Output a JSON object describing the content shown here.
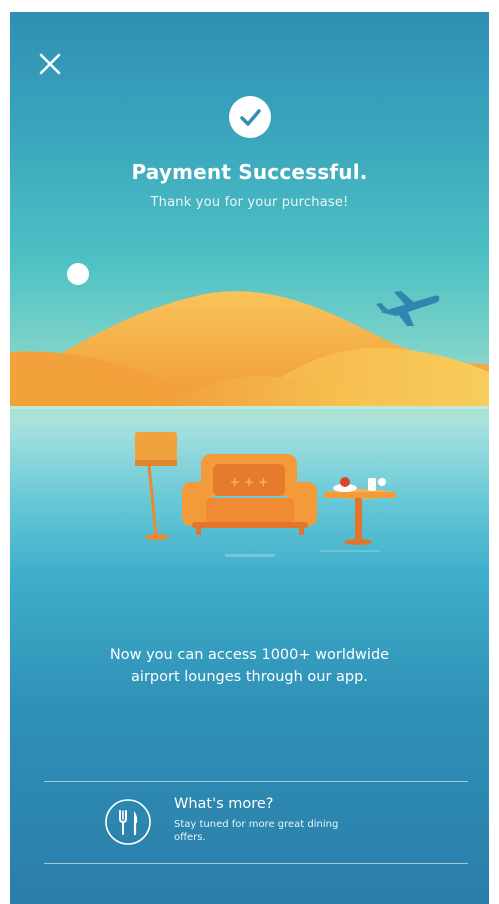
{
  "header": {
    "title": "Payment Successful.",
    "subtitle": "Thank you for your purchase!"
  },
  "main": {
    "message_line1": "Now you can access 1000+ worldwide",
    "message_line2": "airport lounges through our app."
  },
  "promo": {
    "title": "What's more?",
    "text_line1": "Stay tuned for more great dining",
    "text_line2": "offers."
  },
  "icons": {
    "close": "close-icon",
    "success": "check-circle-icon",
    "dining": "fork-knife-icon"
  },
  "colors": {
    "sky_top": "#2f8fb4",
    "horizon": "#aee2d6",
    "dune_orange": "#f2a33a",
    "dune_yellow": "#f7c34e",
    "sofa": "#f39a3a",
    "check": "#2f8fb4"
  }
}
